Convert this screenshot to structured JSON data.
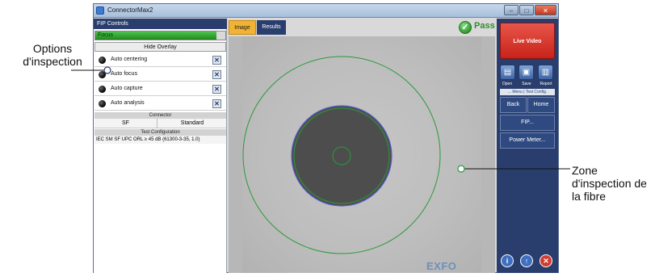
{
  "window": {
    "title": "ConnectorMax2",
    "controls": {
      "minimize": "–",
      "maximize": "□",
      "close": "✕"
    }
  },
  "left_panel": {
    "header": "FIP Controls",
    "focus_label": "Focus",
    "focus_level": 0.93,
    "hide_overlay": "Hide Overlay",
    "options": [
      {
        "label": "Auto centering"
      },
      {
        "label": "Auto focus"
      },
      {
        "label": "Auto capture"
      },
      {
        "label": "Auto analysis"
      }
    ],
    "connector": {
      "header": "Connector",
      "type": "SF",
      "standard": "Standard"
    },
    "test_config": {
      "header": "Test Configuration",
      "value": "IEC SM SF UPC ORL ≥ 45 dB (61300-3-35, 1.0)"
    }
  },
  "tabs": [
    {
      "label": "Image"
    },
    {
      "label": "Results"
    }
  ],
  "pass_label": "Pass",
  "brand": "EXFO",
  "right_panel": {
    "live_video": "Live Video",
    "tools": [
      {
        "label": "Open",
        "icon": "folder-icon"
      },
      {
        "label": "Save",
        "icon": "save-icon"
      },
      {
        "label": "Report",
        "icon": "report-icon"
      }
    ],
    "menu_tabs": "... Menu | Test Config.",
    "back": "Back",
    "home": "Home",
    "fip": "FIP...",
    "power_meter": "Power Meter...",
    "bottom_buttons": [
      {
        "icon": "info-icon"
      },
      {
        "icon": "upload-icon"
      },
      {
        "icon": "close-icon"
      }
    ]
  },
  "annotations": {
    "options_label": "Options d'inspection",
    "zone_label": "Zone d'inspection de la fibre"
  },
  "colors": {
    "accent_navy": "#2a3e6e",
    "tab_active": "#f2b233",
    "pass_green": "#2e8f2e",
    "live_video_red": "#d0352a",
    "callout_green": "#2a9a3a"
  }
}
